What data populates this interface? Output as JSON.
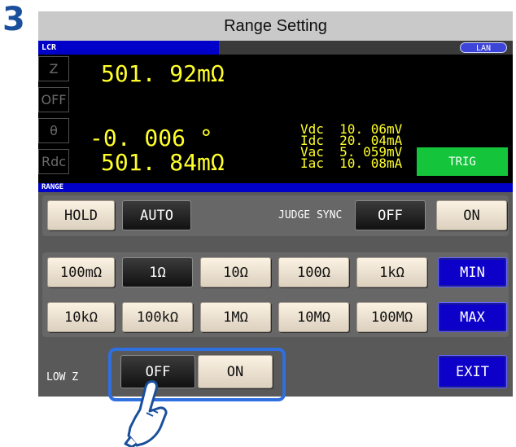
{
  "step_number": "3",
  "window_title": "Range Setting",
  "header": {
    "mode_label": "LCR",
    "lan_label": "LAN"
  },
  "params": [
    "Z",
    "OFF",
    "θ",
    "Rdc"
  ],
  "readings": {
    "z": "501. 92mΩ",
    "theta": "-0. 006 °",
    "rdc": "501. 84mΩ"
  },
  "monitor": [
    {
      "name": "Vdc",
      "value": "10. 06mV"
    },
    {
      "name": "Idc",
      "value": "20. 04mA"
    },
    {
      "name": "Vac",
      "value": "5. 059mV"
    },
    {
      "name": "Iac",
      "value": "10. 08mA"
    }
  ],
  "trig_label": "TRIG",
  "range_section_label": "RANGE",
  "hold_label": "HOLD",
  "auto_label": "AUTO",
  "judge_sync_label": "JUDGE SYNC",
  "judge_off_label": "OFF",
  "judge_on_label": "ON",
  "ranges_row1": [
    "100mΩ",
    "1Ω",
    "10Ω",
    "100Ω",
    "1kΩ"
  ],
  "ranges_row2": [
    "10kΩ",
    "100kΩ",
    "1MΩ",
    "10MΩ",
    "100MΩ"
  ],
  "min_label": "MIN",
  "max_label": "MAX",
  "lowz_label": "LOW Z",
  "lowz_off_label": "OFF",
  "lowz_on_label": "ON",
  "exit_label": "EXIT",
  "icons": {
    "pointer": "pointing-hand-icon"
  }
}
